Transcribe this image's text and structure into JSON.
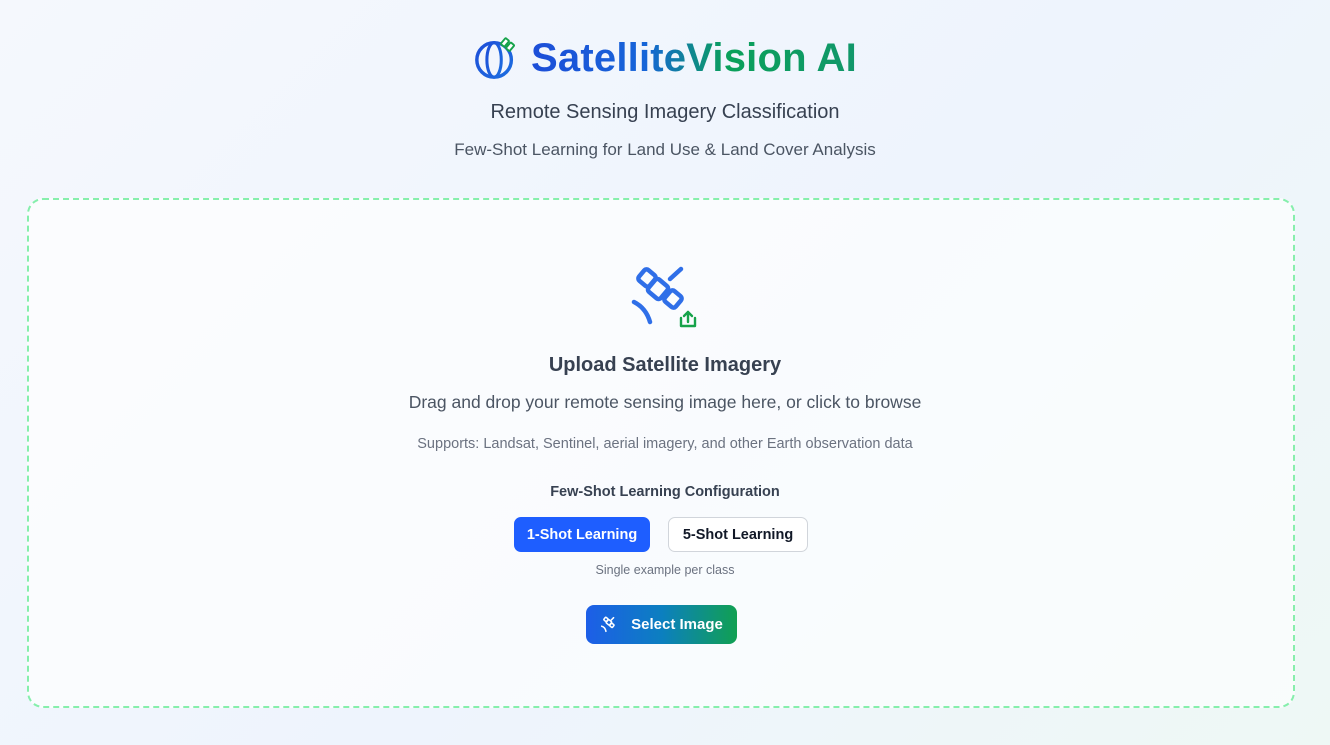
{
  "app": {
    "title": "SatelliteVision AI",
    "subtitle": "Remote Sensing Imagery Classification",
    "tagline": "Few-Shot Learning for Land Use & Land Cover Analysis",
    "brand_icon": "globe-satellite-icon"
  },
  "upload": {
    "icon": "satellite-upload-icon",
    "title": "Upload Satellite Imagery",
    "description": "Drag and drop your remote sensing image here, or click to browse",
    "supports": "Supports: Landsat, Sentinel, aerial imagery, and other Earth observation data"
  },
  "config": {
    "title": "Few-Shot Learning Configuration",
    "options": [
      {
        "label": "1-Shot Learning",
        "selected": true
      },
      {
        "label": "5-Shot Learning",
        "selected": false
      }
    ],
    "hint": "Single example per class"
  },
  "select_button": {
    "label": "Select Image",
    "icon": "satellite-icon"
  },
  "colors": {
    "primary_blue": "#1e5eff",
    "accent_green": "#11a052",
    "dropzone_border": "#86efac"
  }
}
